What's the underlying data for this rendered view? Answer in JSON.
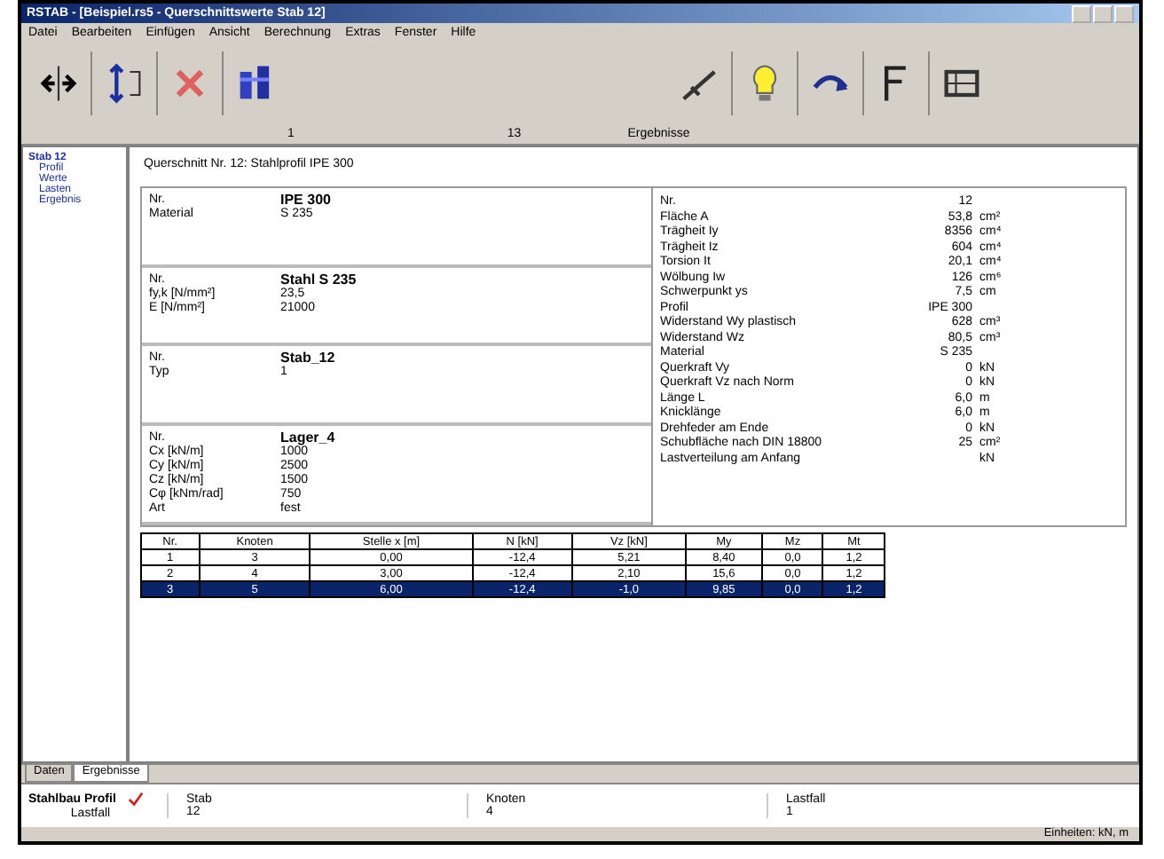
{
  "window": {
    "title": "RSTAB - [Beispiel.rs5 - Querschnittswerte Stab 12]"
  },
  "menu": [
    "Datei",
    "Bearbeiten",
    "Einfügen",
    "Ansicht",
    "Berechnung",
    "Extras",
    "Fenster",
    "Hilfe"
  ],
  "toolbar": {
    "captions": [
      "1",
      "13",
      "Ergebnisse"
    ]
  },
  "tree": [
    {
      "label": "Stab 12",
      "expanded": true,
      "children": [
        {
          "label": "Profil"
        },
        {
          "label": "Werte"
        },
        {
          "label": "Lasten"
        },
        {
          "label": "Ergebnis"
        }
      ]
    }
  ],
  "heading": "Querschnitt Nr. 12: Stahlprofil IPE 300",
  "sections": [
    {
      "title": "IPE 300",
      "rows": [
        {
          "label": "Nr."
        },
        {
          "label": "Material",
          "value": "S 235"
        }
      ]
    },
    {
      "title": "Stahl S 235",
      "rows": [
        {
          "label": "Nr."
        },
        {
          "label": "fy,k [N/mm²]",
          "value": "23,5"
        },
        {
          "label": "E [N/mm²]",
          "value": "21000"
        }
      ]
    },
    {
      "title": "Stab_12",
      "rows": [
        {
          "label": "Nr."
        },
        {
          "label": "Typ",
          "value": "1"
        }
      ]
    },
    {
      "title": "Lager_4",
      "rows": [
        {
          "label": "Nr."
        },
        {
          "label": "Cx [kN/m]",
          "value": "1000"
        },
        {
          "label": "Cy [kN/m]",
          "value": "2500"
        },
        {
          "label": "Cz [kN/m]",
          "value": "1500"
        },
        {
          "label": "Cφ [kNm/rad]",
          "value": "750"
        },
        {
          "label": "Art",
          "value": "fest"
        }
      ]
    }
  ],
  "properties": [
    {
      "label": "Nr.",
      "value": "12"
    },
    {
      "label": "Fläche A",
      "value": "53,8",
      "unit": "cm²"
    },
    {
      "label": "Trägheit Iy",
      "value": "8356",
      "unit": "cm⁴"
    },
    {
      "label": "Trägheit Iz",
      "value": "604",
      "unit": "cm⁴"
    },
    {
      "label": "Torsion It",
      "value": "20,1",
      "unit": "cm⁴"
    },
    {
      "label": "Wölbung Iw",
      "value": "126",
      "unit": "cm⁶"
    },
    {
      "label": "Schwerpunkt ys",
      "value": "7,5",
      "unit": "cm"
    },
    {
      "label": "Profil",
      "value": "IPE 300"
    },
    {
      "label": "Widerstand Wy plastisch",
      "value": "628",
      "unit": "cm³"
    },
    {
      "label": "Widerstand Wz",
      "value": "80,5",
      "unit": "cm³"
    },
    {
      "label": "Material",
      "value": "S 235"
    },
    {
      "label": "Querkraft Vy",
      "value": "0",
      "unit": "kN"
    },
    {
      "label": "Querkraft Vz nach Norm",
      "value": "0",
      "unit": "kN"
    },
    {
      "label": "Länge L",
      "value": "6,0",
      "unit": "m"
    },
    {
      "label": "Knicklänge",
      "value": "6,0",
      "unit": "m"
    },
    {
      "label": "Drehfeder am Ende",
      "value": "0",
      "unit": "kN"
    },
    {
      "label": "Schubfläche nach DIN 18800",
      "value": "25",
      "unit": "cm²"
    },
    {
      "label": "Lastverteilung am Anfang",
      "unit": "kN"
    }
  ],
  "table": {
    "columns": [
      "Nr.",
      "Knoten",
      "Stelle x [m]",
      "N [kN]",
      "Vz [kN]",
      "My",
      "Mz",
      "Mt"
    ],
    "rows": [
      {
        "cells": [
          "1",
          "3",
          "0,00",
          "-12,4",
          "5,21",
          "8,40",
          "0,0",
          "1,2"
        ],
        "selected": false
      },
      {
        "cells": [
          "2",
          "4",
          "3,00",
          "-12,4",
          "2,10",
          "15,6",
          "0,0",
          "1,2"
        ],
        "selected": false
      },
      {
        "cells": [
          "3",
          "5",
          "6,00",
          "-12,4",
          "-1,0",
          "9,85",
          "0,0",
          "1,2"
        ],
        "selected": true
      }
    ]
  },
  "bottom_tabs": [
    {
      "label": "Daten",
      "selected": false
    },
    {
      "label": "Ergebnisse",
      "selected": true
    }
  ],
  "profile": {
    "title": "Stahlbau Profil",
    "subtitle": "Lastfall"
  },
  "fields": [
    {
      "label": "Stab",
      "value": "12"
    },
    {
      "label": "Knoten",
      "value": "4"
    },
    {
      "label": "Lastfall",
      "value": "1"
    }
  ],
  "status": "Einheiten: kN, m"
}
